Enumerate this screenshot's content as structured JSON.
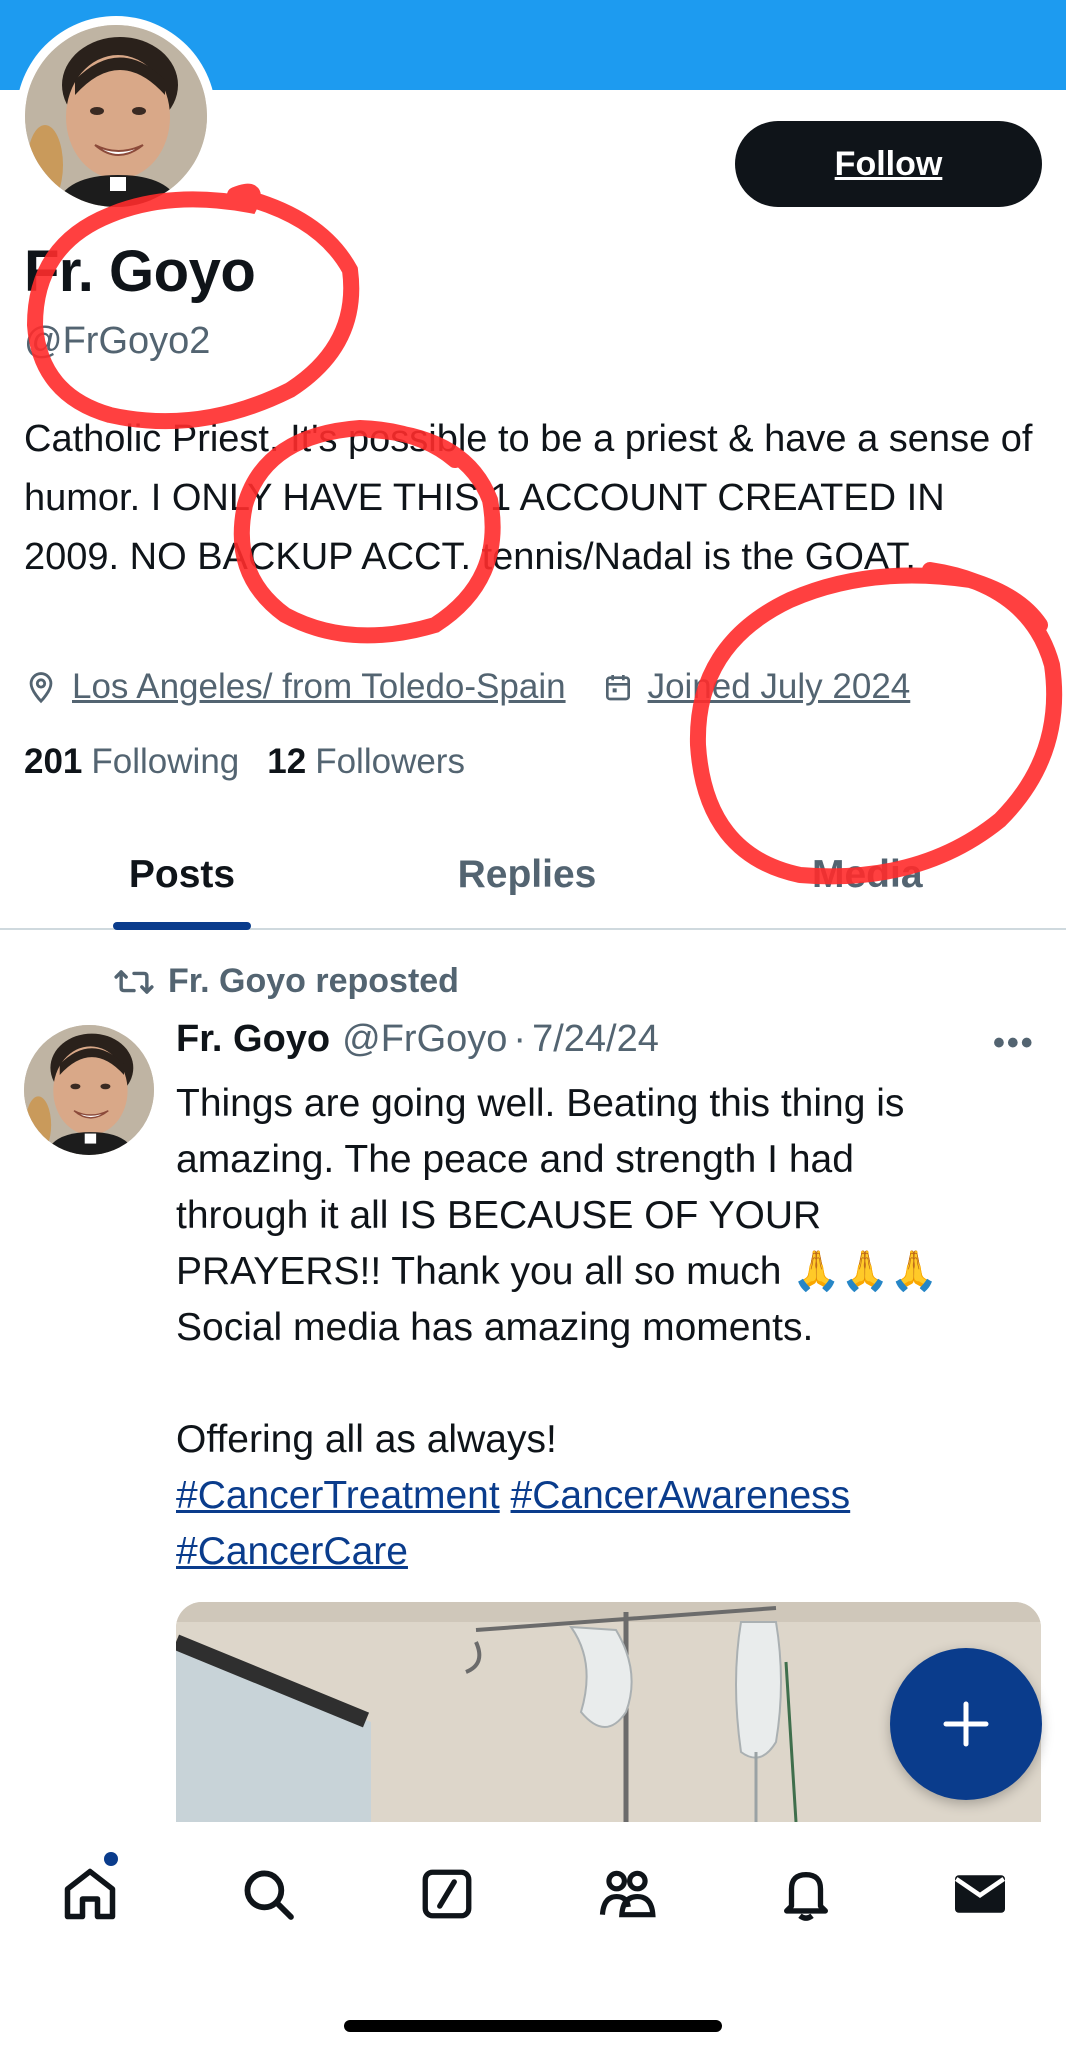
{
  "colors": {
    "banner": "#1d9bf0",
    "accent": "#0a3c8c",
    "text_primary": "#0f1419",
    "text_secondary": "#536471",
    "annotation_red": "#ff2b2b"
  },
  "header": {
    "follow_label": "Follow"
  },
  "profile": {
    "name": "Fr. Goyo",
    "handle": "@FrGoyo2",
    "bio": "Catholic Priest. It's possible to be a priest & have a sense of humor. I ONLY HAVE THIS 1 ACCOUNT CREATED IN 2009. NO BACKUP ACCT. tennis/Nadal is the GOAT.",
    "location": "Los Angeles/ from Toledo-Spain",
    "location_icon": "location-pin-icon",
    "joined": "Joined July 2024",
    "joined_icon": "calendar-icon",
    "following_count": "201",
    "following_label": "Following",
    "followers_count": "12",
    "followers_label": "Followers"
  },
  "tabs": [
    {
      "label": "Posts",
      "active": true
    },
    {
      "label": "Replies",
      "active": false
    },
    {
      "label": "Media",
      "active": false
    }
  ],
  "post": {
    "repost_label": "Fr. Goyo reposted",
    "repost_icon": "repost-icon",
    "author_name": "Fr. Goyo",
    "author_handle": "@FrGoyo",
    "separator": "·",
    "date": "7/24/24",
    "more_icon": "more-options-icon",
    "text_lines": [
      "Things are going well. Beating this thing is",
      "amazing. The peace and strength I had",
      "through it all IS BECAUSE OF YOUR",
      "PRAYERS!! Thank you all so much",
      "Social media has amazing moments.",
      "",
      "Offering all as always!"
    ],
    "emoji": "🙏🙏🙏",
    "hashtags": [
      "#CancerTreatment",
      "#CancerAwareness",
      "#CancerCare"
    ]
  },
  "fab": {
    "icon": "plus-icon"
  },
  "bottom_nav": [
    {
      "name": "home",
      "icon": "home-icon",
      "has_dot": true
    },
    {
      "name": "search",
      "icon": "search-icon",
      "has_dot": false
    },
    {
      "name": "grok",
      "icon": "grok-icon",
      "has_dot": false
    },
    {
      "name": "communities",
      "icon": "communities-icon",
      "has_dot": false
    },
    {
      "name": "notifications",
      "icon": "bell-icon",
      "has_dot": false
    },
    {
      "name": "messages",
      "icon": "envelope-icon",
      "has_dot": false
    }
  ]
}
